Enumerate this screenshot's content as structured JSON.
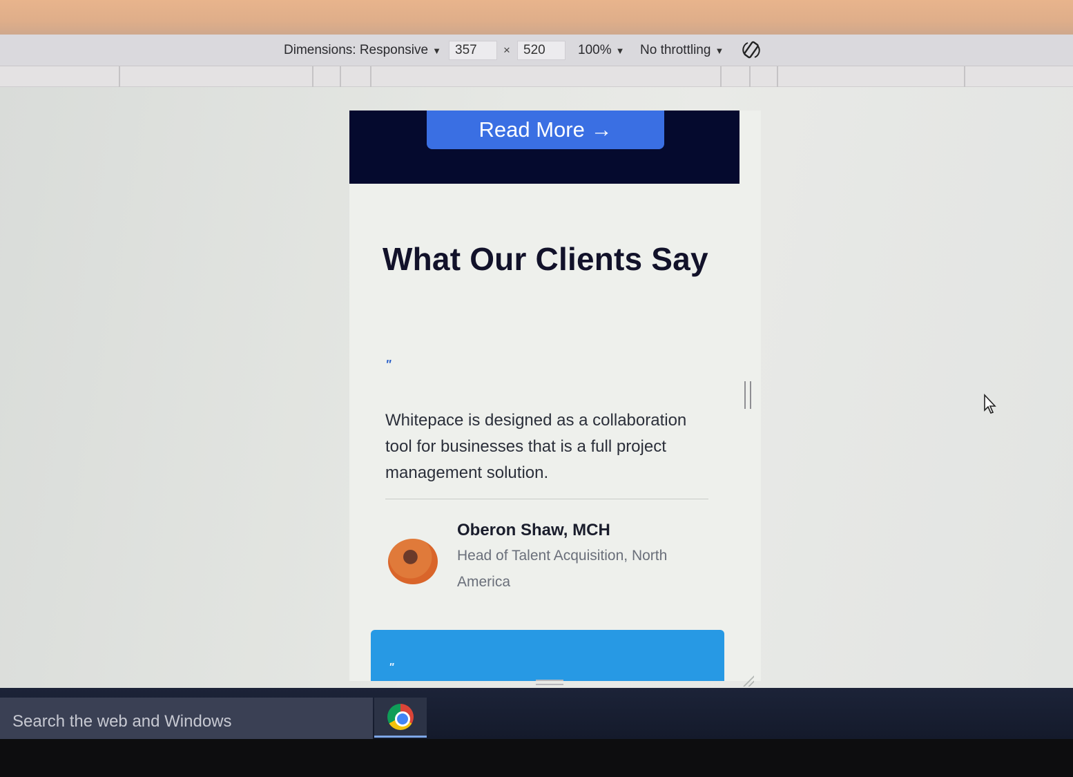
{
  "device_toolbar": {
    "dimensions_label": "Dimensions: Responsive",
    "width_value": "357",
    "times_symbol": "×",
    "height_value": "520",
    "zoom_label": "100%",
    "throttling_label": "No throttling",
    "dropdown_caret": "▼",
    "rotate_icon": "rotate-icon"
  },
  "page": {
    "read_more_label": "Read More →",
    "testimonials": {
      "title": "What Our Clients Say",
      "quote_mark": "\"",
      "quote": "Whitepace is designed as a collaboration tool for businesses that is a full project management solution.",
      "author_name": "Oberon Shaw, MCH",
      "author_role": "Head of Talent Acquisition, North America"
    },
    "next_card_quote_mark": "\""
  },
  "taskbar": {
    "search_placeholder": "Search the web and Windows",
    "pinned_app": "chrome-icon"
  },
  "colors": {
    "hero_band": "#050a2e",
    "button_blue": "#3a6fe3",
    "card_blue": "#2799e4",
    "title_text": "#12122a"
  }
}
